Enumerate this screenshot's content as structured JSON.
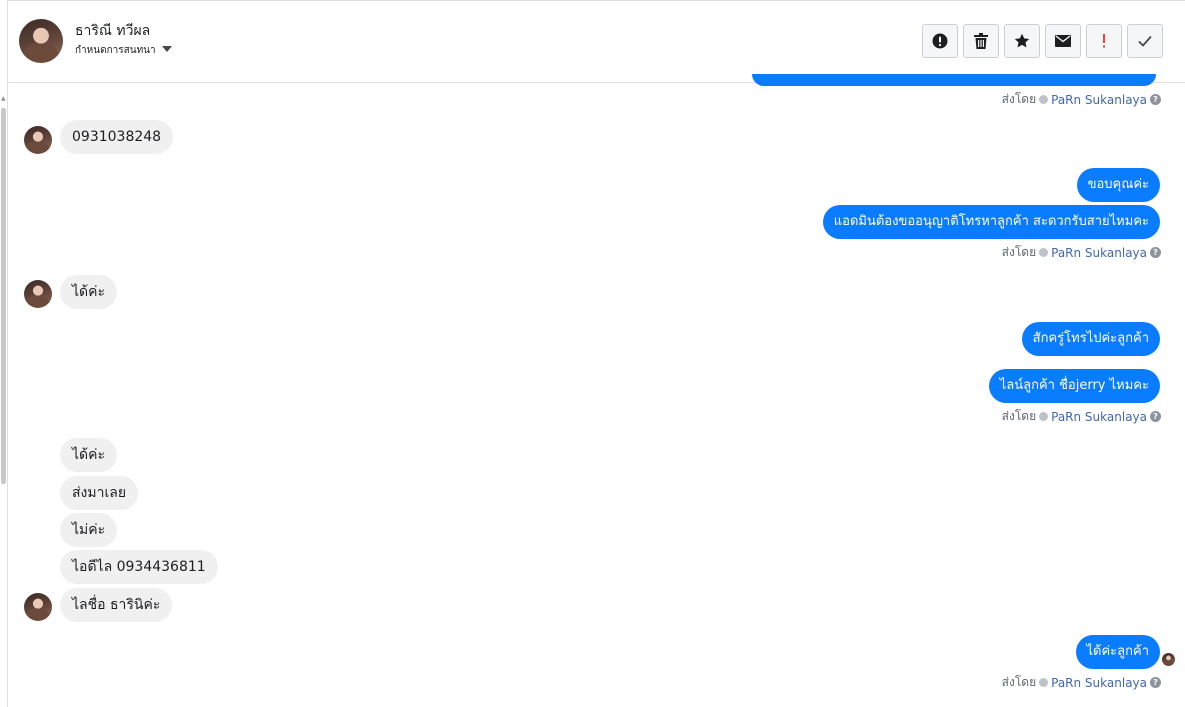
{
  "header": {
    "name": "ธาริณี ทวีผล",
    "subtitle": "กำหนดการสนทนา",
    "actions": [
      {
        "icon": "exclamation-circle-icon",
        "label": "Mark as spam"
      },
      {
        "icon": "trash-icon",
        "label": "Delete"
      },
      {
        "icon": "star-icon",
        "label": "Star"
      },
      {
        "icon": "envelope-icon",
        "label": "Mark unread"
      },
      {
        "icon": "important-icon",
        "label": "Important"
      },
      {
        "icon": "check-icon",
        "label": "Done"
      }
    ]
  },
  "conversation": {
    "sent_by_prefix": "ส่งโดย",
    "agent_name": "PaRn Sukanlaya",
    "messages": [
      {
        "dir": "in",
        "text": "0931038248"
      },
      {
        "dir": "out",
        "text": "ขอบคุณค่ะ"
      },
      {
        "dir": "out",
        "text": "แอดมินต้องขออนุญาติโทรหาลูกค้า สะดวกรับสายไหมคะ"
      },
      {
        "dir": "in",
        "text": "ได้ค่ะ"
      },
      {
        "dir": "out",
        "text": "สักครู่โทรไปค่ะลูกค้า"
      },
      {
        "dir": "out",
        "text": "ไลน์ลูกค้า ชื่อjerry ไหมคะ"
      },
      {
        "dir": "in",
        "text": "ได้ค่ะ"
      },
      {
        "dir": "in",
        "text": "ส่งมาเลย"
      },
      {
        "dir": "in",
        "text": "ไม่ค่ะ"
      },
      {
        "dir": "in",
        "text": "ไอดีไล 0934436811"
      },
      {
        "dir": "in",
        "text": "ไลชื่อ ธารินิค่ะ"
      },
      {
        "dir": "out",
        "text": "ได้ค่ะลูกค้า"
      }
    ]
  }
}
